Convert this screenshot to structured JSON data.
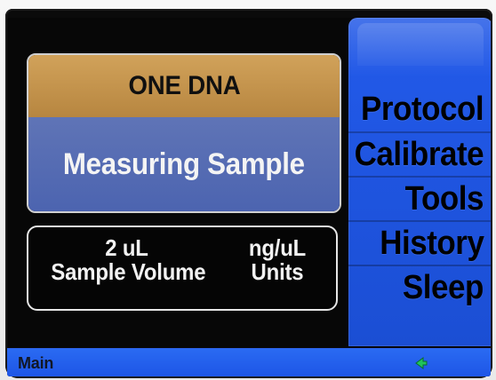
{
  "assay": {
    "name": "ONE DNA"
  },
  "status": {
    "message": "Measuring Sample"
  },
  "settings": {
    "sample_volume": {
      "value": "2 uL",
      "label": "Sample Volume"
    },
    "units": {
      "value": "ng/uL",
      "label": "Units"
    }
  },
  "menu": {
    "items": [
      {
        "label": "Protocol"
      },
      {
        "label": "Calibrate"
      },
      {
        "label": "Tools"
      },
      {
        "label": "History"
      },
      {
        "label": "Sleep"
      }
    ]
  },
  "status_bar": {
    "label": "Main"
  },
  "icons": {
    "nav_indicator": "green-arrow-left-icon"
  },
  "colors": {
    "menu_blue": "#1d55e6",
    "header_gold": "#c7974d",
    "status_blue": "#5670b2",
    "indicator_green": "#20c35b"
  }
}
